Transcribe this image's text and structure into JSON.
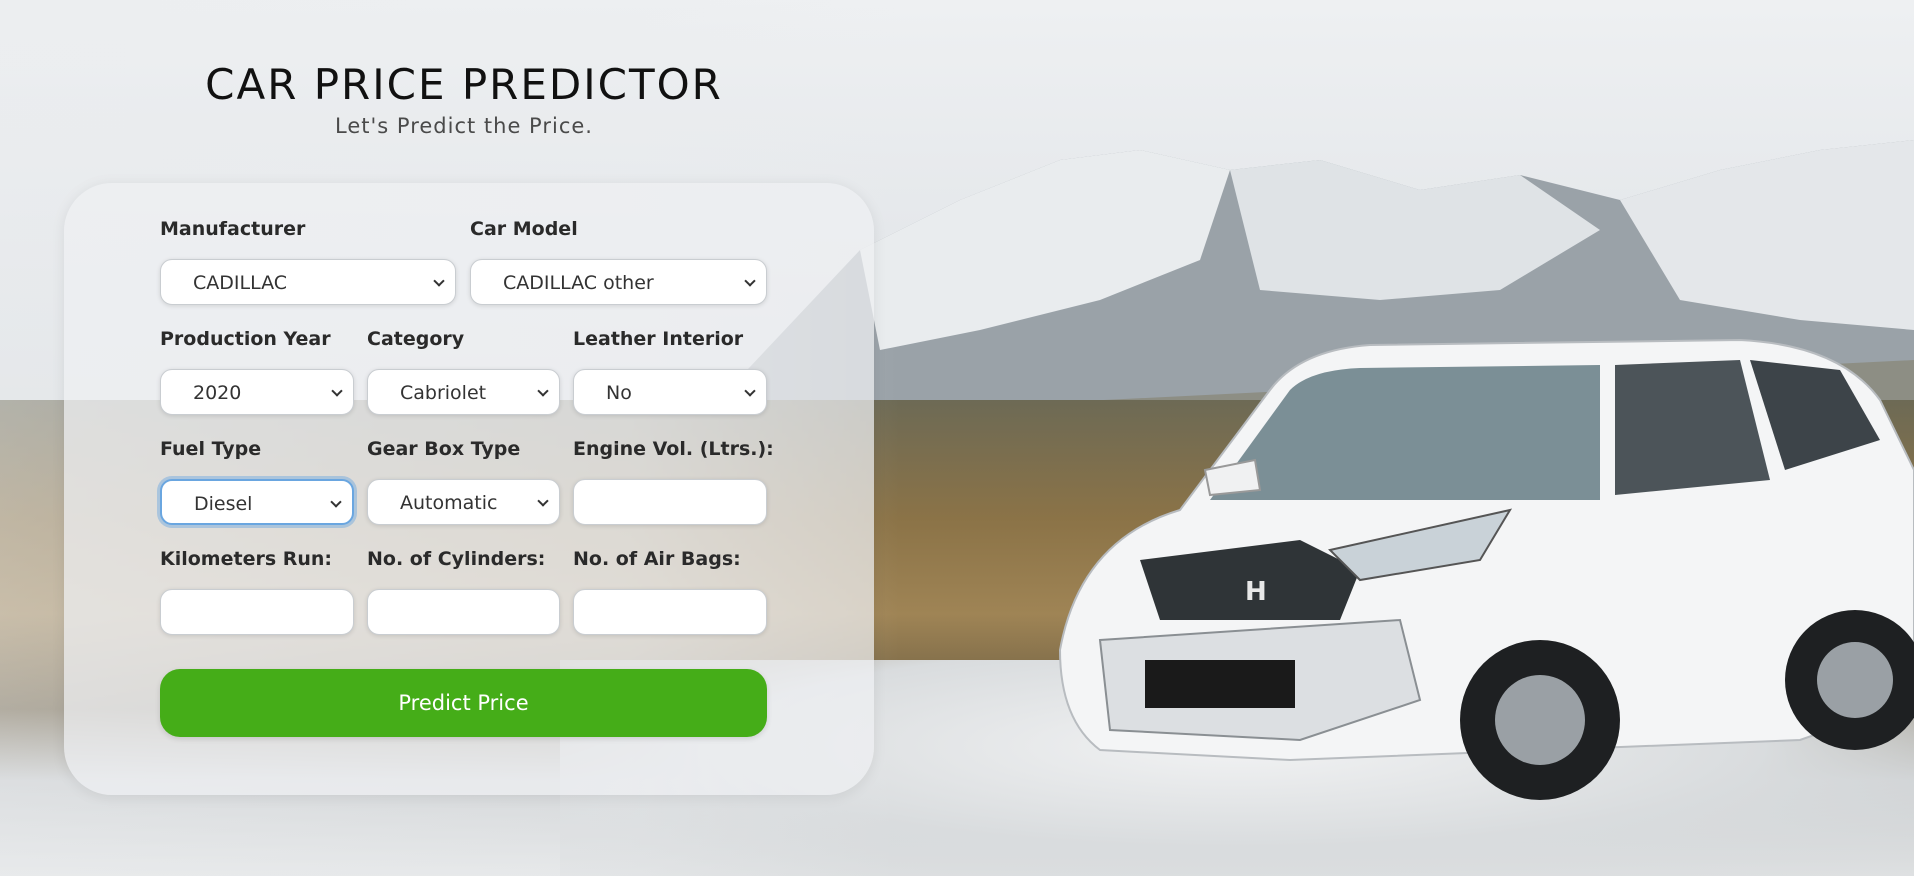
{
  "header": {
    "title": "CAR PRICE PREDICTOR",
    "subtitle": "Let's Predict the Price."
  },
  "form": {
    "manufacturer": {
      "label": "Manufacturer",
      "value": "CADILLAC"
    },
    "car_model": {
      "label": "Car Model",
      "value": "CADILLAC other"
    },
    "production_year": {
      "label": "Production Year",
      "value": "2020"
    },
    "category": {
      "label": "Category",
      "value": "Cabriolet"
    },
    "leather_interior": {
      "label": "Leather Interior",
      "value": "No"
    },
    "fuel_type": {
      "label": "Fuel Type",
      "value": "Diesel"
    },
    "gear_box_type": {
      "label": "Gear Box Type",
      "value": "Automatic"
    },
    "engine_volume": {
      "label": "Engine Vol. (Ltrs.):",
      "value": ""
    },
    "kilometers_run": {
      "label": "Kilometers Run:",
      "value": ""
    },
    "cylinders": {
      "label": "No. of Cylinders:",
      "value": ""
    },
    "air_bags": {
      "label": "No. of Air Bags:",
      "value": ""
    },
    "submit_label": "Predict Price"
  },
  "colors": {
    "accent": "#45ad18",
    "focus": "#6aa6e0"
  }
}
